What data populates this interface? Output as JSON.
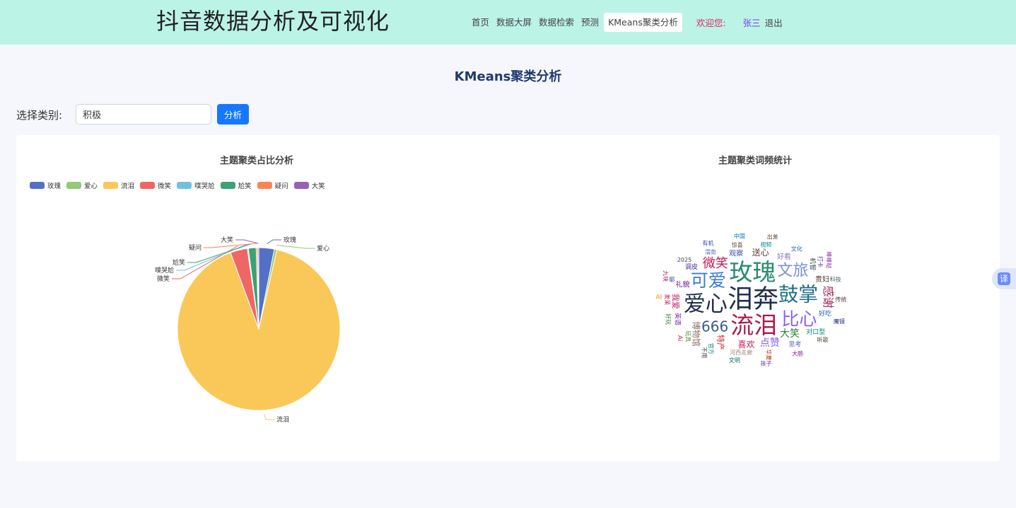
{
  "header": {
    "app_title": "抖音数据分析及可视化",
    "nav": [
      {
        "label": "首页",
        "active": false
      },
      {
        "label": "数据大屏",
        "active": false
      },
      {
        "label": "数据检索",
        "active": false
      },
      {
        "label": "预测",
        "active": false
      },
      {
        "label": "KMeans聚类分析",
        "active": true
      }
    ],
    "welcome": "欢迎您:",
    "username": "张三",
    "logout": "退出"
  },
  "page": {
    "title": "KMeans聚类分析"
  },
  "filter": {
    "label": "选择类别:",
    "value": "积极",
    "button": "分析"
  },
  "translate_icon": "译",
  "colors": {
    "header_bg": "#bcf3e7",
    "primary": "#1677ff",
    "welcome": "#e0245e",
    "username": "#7a3ee0"
  },
  "chart_data": [
    {
      "type": "pie",
      "title": "主题聚类占比分析",
      "legend_position": "top-left",
      "slices": [
        {
          "name": "玫瑰",
          "value": 3.0,
          "color": "#5470c6"
        },
        {
          "name": "爱心",
          "value": 0.5,
          "color": "#91cc75"
        },
        {
          "name": "流泪",
          "value": 88.5,
          "color": "#fac858"
        },
        {
          "name": "微笑",
          "value": 3.3,
          "color": "#ee6666"
        },
        {
          "name": "噗哭尬",
          "value": 0.2,
          "color": "#73c0de"
        },
        {
          "name": "尬笑",
          "value": 1.5,
          "color": "#3ba272"
        },
        {
          "name": "疑问",
          "value": 0.3,
          "color": "#fc8452"
        },
        {
          "name": "大笑",
          "value": 0.2,
          "color": "#9a60b4"
        }
      ]
    },
    {
      "type": "wordcloud",
      "title": "主题聚类词频统计",
      "words": [
        {
          "text": "泪奔",
          "weight": 36,
          "color": "#1f2e4a"
        },
        {
          "text": "流泪",
          "weight": 33,
          "color": "#a61d4d"
        },
        {
          "text": "玫瑰",
          "weight": 33,
          "color": "#2a8a6e"
        },
        {
          "text": "爱心",
          "weight": 31,
          "color": "#1f2e4a"
        },
        {
          "text": "鼓掌",
          "weight": 28,
          "color": "#1f6e8c"
        },
        {
          "text": "可爱",
          "weight": 25,
          "color": "#3a7bd5"
        },
        {
          "text": "比心",
          "weight": 25,
          "color": "#8b5cf6"
        },
        {
          "text": "文旅",
          "weight": 22,
          "color": "#7a8fd6"
        },
        {
          "text": "666",
          "weight": 20,
          "color": "#3b5a8c"
        },
        {
          "text": "微笑",
          "weight": 18,
          "color": "#c2185b"
        },
        {
          "text": "感谢",
          "weight": 16,
          "color": "#9c2b5a"
        },
        {
          "text": "大笑",
          "weight": 14,
          "color": "#2e7d32"
        },
        {
          "text": "点赞",
          "weight": 14,
          "color": "#8b5cf6"
        },
        {
          "text": "博物馆",
          "weight": 12,
          "color": "#8d6e63"
        },
        {
          "text": "喜欢",
          "weight": 12,
          "color": "#c2185b"
        },
        {
          "text": "送心",
          "weight": 12,
          "color": "#5d4037"
        },
        {
          "text": "特产",
          "weight": 11,
          "color": "#c62828"
        },
        {
          "text": "观察",
          "weight": 10,
          "color": "#3949ab"
        },
        {
          "text": "好看",
          "weight": 10,
          "color": "#8e7cc3"
        },
        {
          "text": "我爱",
          "weight": 11,
          "color": "#c2185b"
        },
        {
          "text": "礼貌",
          "weight": 10,
          "color": "#6a1b9a"
        },
        {
          "text": "贵妇",
          "weight": 10,
          "color": "#4e342e"
        },
        {
          "text": "机智",
          "weight": 9,
          "color": "#37474f"
        },
        {
          "text": "好吃",
          "weight": 9,
          "color": "#1565c0"
        },
        {
          "text": "调皮",
          "weight": 9,
          "color": "#4527a0"
        },
        {
          "text": "英语",
          "weight": 9,
          "color": "#7b1fa2"
        },
        {
          "text": "对口型",
          "weight": 9,
          "color": "#00897b"
        },
        {
          "text": "思考",
          "weight": 9,
          "color": "#5c6bc0"
        },
        {
          "text": "华夏",
          "weight": 8,
          "color": "#bf360c"
        },
        {
          "text": "河西走廊",
          "weight": 8,
          "color": "#a1887f"
        },
        {
          "text": "渭南",
          "weight": 8,
          "color": "#5c6bc0"
        },
        {
          "text": "官方",
          "weight": 8,
          "color": "#00897b"
        },
        {
          "text": "惊喜",
          "weight": 8,
          "color": "#6d4c41"
        },
        {
          "text": "视频",
          "weight": 8,
          "color": "#00838f"
        },
        {
          "text": "玩具",
          "weight": 8,
          "color": "#558b2f"
        },
        {
          "text": "文化",
          "weight": 8,
          "color": "#1565c0"
        },
        {
          "text": "科技",
          "weight": 8,
          "color": "#455a64"
        },
        {
          "text": "发呆",
          "weight": 8,
          "color": "#ad1457"
        },
        {
          "text": "耶",
          "weight": 8,
          "color": "#283593"
        },
        {
          "text": "传统",
          "weight": 8,
          "color": "#4e342e"
        },
        {
          "text": "打卡",
          "weight": 8,
          "color": "#6a1b9a"
        },
        {
          "text": "2025",
          "weight": 8,
          "color": "#37474f"
        },
        {
          "text": "魔镜",
          "weight": 8,
          "color": "#1a237e"
        },
        {
          "text": "好玩",
          "weight": 8,
          "color": "#2e7d32"
        },
        {
          "text": "听歌",
          "weight": 8,
          "color": "#5d4037"
        },
        {
          "text": "大肠",
          "weight": 8,
          "color": "#7b1fa2"
        },
        {
          "text": "不用",
          "weight": 8,
          "color": "#37474f"
        },
        {
          "text": "文明",
          "weight": 8,
          "color": "#00695c"
        },
        {
          "text": "有机",
          "weight": 8,
          "color": "#3949ab"
        },
        {
          "text": "Ai",
          "weight": 9,
          "color": "#c2185b"
        },
        {
          "text": "AI",
          "weight": 9,
          "color": "#fb8c00"
        },
        {
          "text": "中国",
          "weight": 8,
          "color": "#0277bd"
        },
        {
          "text": "九块",
          "weight": 8,
          "color": "#ad1457"
        },
        {
          "text": "出差",
          "weight": 8,
          "color": "#6d4c41"
        },
        {
          "text": "孩子",
          "weight": 8,
          "color": "#5e35b1"
        },
        {
          "text": "棒棒哒",
          "weight": 8,
          "color": "#8e24aa"
        }
      ]
    }
  ]
}
